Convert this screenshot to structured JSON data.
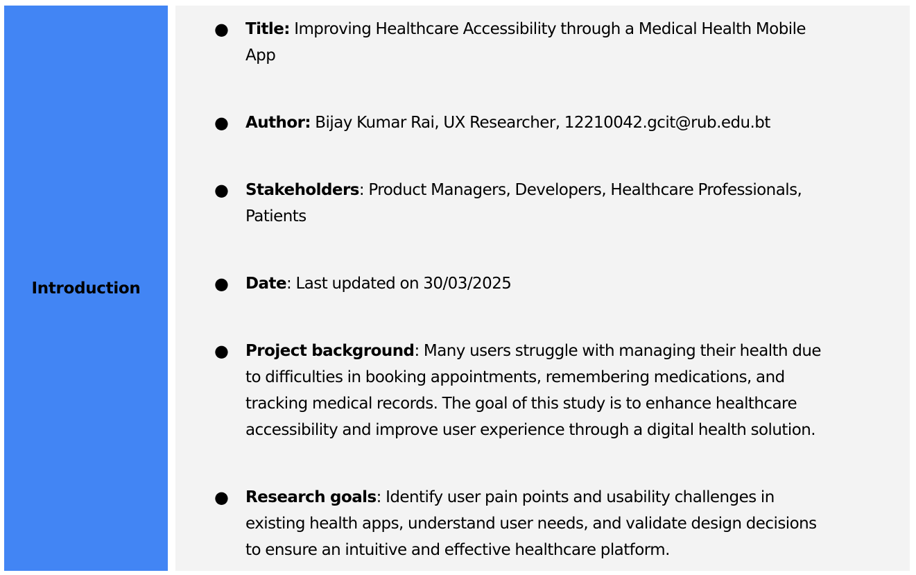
{
  "section": {
    "label": "Introduction"
  },
  "items": [
    {
      "bullet": "●",
      "term": "Title:",
      "lines": [
        " Improving Healthcare Accessibility through a Medical Health Mobile",
        "App"
      ]
    },
    {
      "bullet": "●",
      "term": "Author:",
      "lines": [
        " Bijay Kumar Rai, UX Researcher, 12210042.gcit@rub.edu.bt"
      ]
    },
    {
      "bullet": "●",
      "term": "Stakeholders",
      "lines": [
        ": Product Managers, Developers, Healthcare Professionals,",
        "Patients"
      ]
    },
    {
      "bullet": "●",
      "term": "Date",
      "lines": [
        ": Last updated on 30/03/2025"
      ]
    },
    {
      "bullet": "●",
      "term": "Project background",
      "lines": [
        ": Many users struggle with managing their health due",
        "to difficulties in booking appointments, remembering medications, and",
        "tracking medical records. The goal of this study is to enhance healthcare",
        "accessibility and improve user experience through a digital health solution."
      ]
    },
    {
      "bullet": "●",
      "term": "Research goals",
      "lines": [
        ": Identify user pain points and usability challenges in",
        "existing health apps, understand user needs, and validate design decisions",
        "to ensure an intuitive and effective healthcare platform."
      ]
    }
  ]
}
